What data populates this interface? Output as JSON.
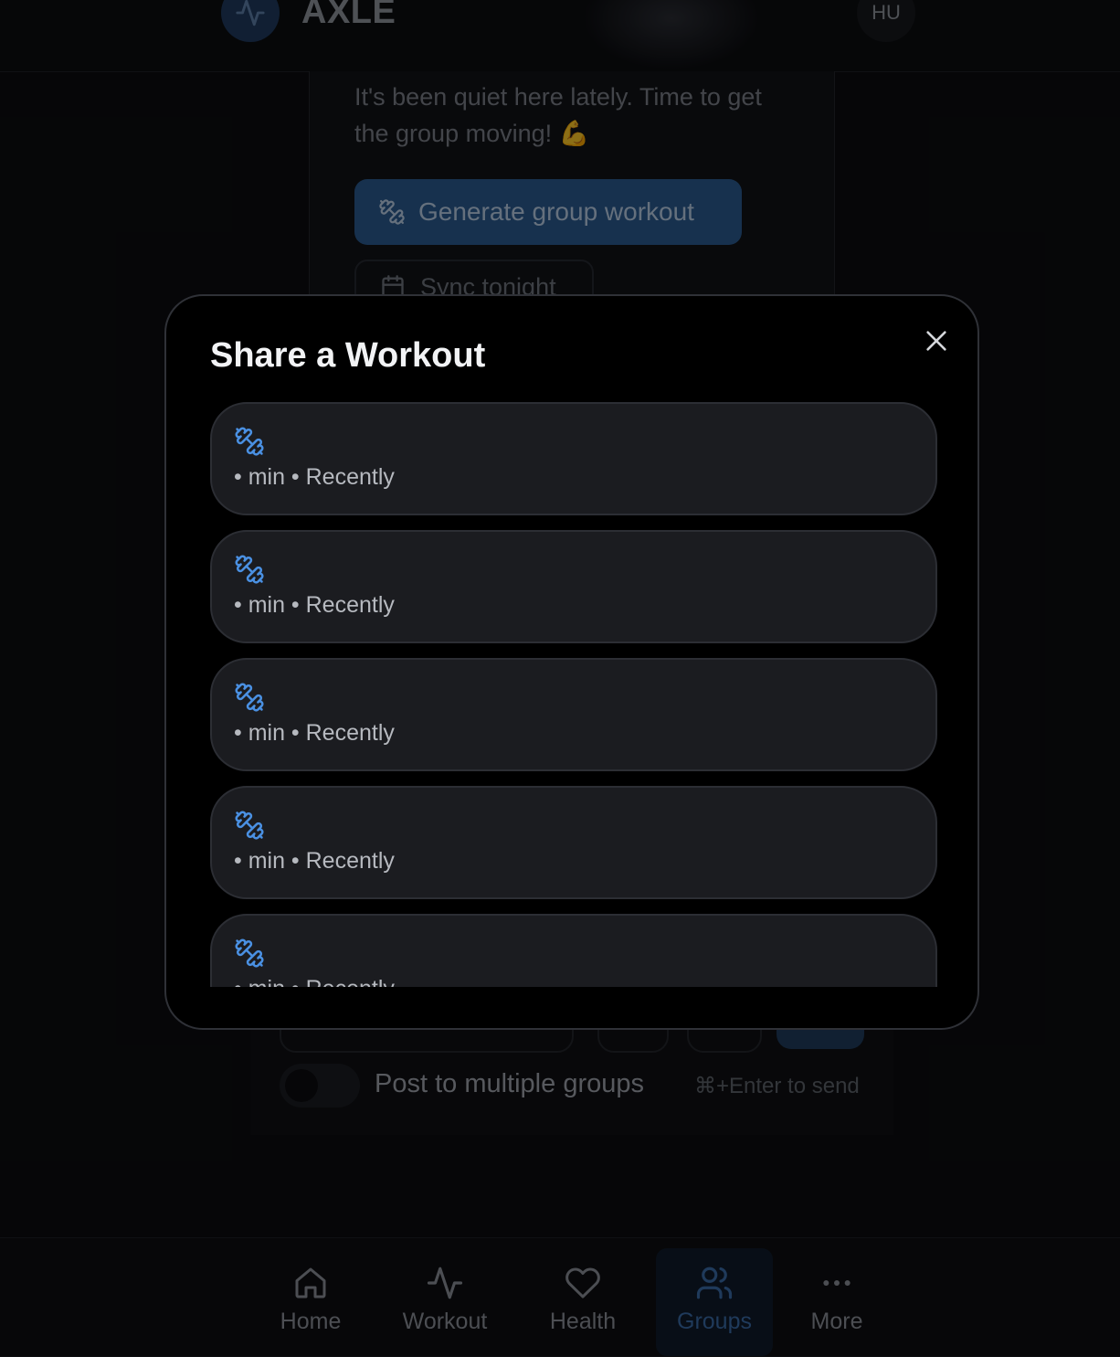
{
  "header": {
    "brand": "AXLE",
    "avatar_initials": "HU"
  },
  "group_card": {
    "quiet_message": "It's been quiet here lately. Time to get the group moving! 💪",
    "generate_button": "Generate group workout",
    "sync_button": "Sync tonight"
  },
  "composer": {
    "multi_group_label": "Post to multiple groups",
    "send_hint": "⌘+Enter to send",
    "multi_group_enabled": false
  },
  "nav": {
    "items": [
      {
        "label": "Home",
        "icon": "home-icon"
      },
      {
        "label": "Workout",
        "icon": "activity-icon"
      },
      {
        "label": "Health",
        "icon": "heart-icon"
      },
      {
        "label": "Groups",
        "icon": "users-icon",
        "active": true
      },
      {
        "label": "More",
        "icon": "more-icon"
      }
    ]
  },
  "modal": {
    "title": "Share a Workout",
    "close_icon": "close-icon",
    "workouts": [
      {
        "meta": "• min • Recently",
        "icon": "dumbbell-icon"
      },
      {
        "meta": "• min • Recently",
        "icon": "dumbbell-icon"
      },
      {
        "meta": "• min • Recently",
        "icon": "dumbbell-icon"
      },
      {
        "meta": "• min • Recently",
        "icon": "dumbbell-icon"
      },
      {
        "meta": "• min • Recently",
        "icon": "dumbbell-icon"
      }
    ]
  },
  "colors": {
    "accent": "#4a90e2",
    "background": "#0b0c0f",
    "modal_bg": "#000000",
    "card_bg": "#1b1c20"
  }
}
